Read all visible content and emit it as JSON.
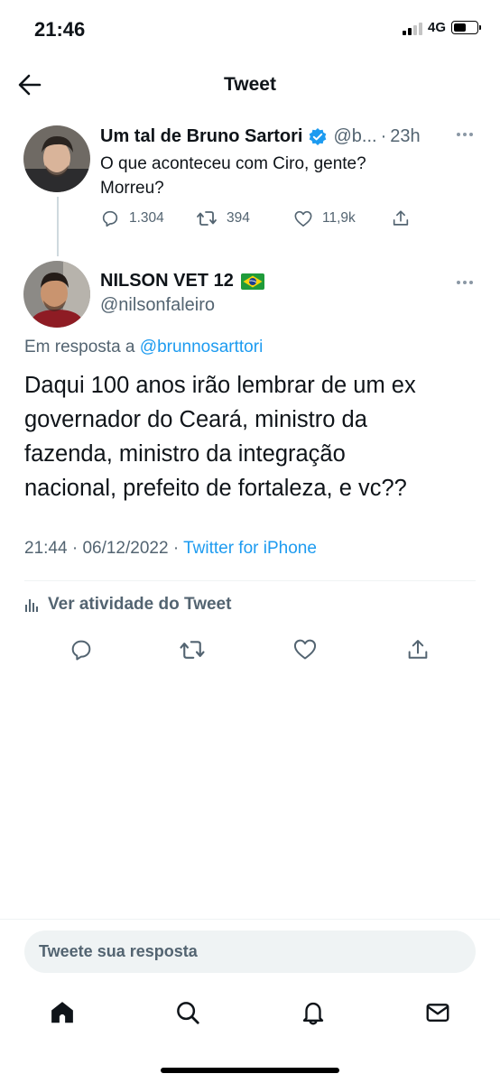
{
  "status_bar": {
    "time": "21:46",
    "network": "4G"
  },
  "header": {
    "title": "Tweet"
  },
  "parent_tweet": {
    "display_name": "Um tal de Bruno Sartori",
    "handle": "@b...",
    "separator": "·",
    "time_ago": "23h",
    "text_line1": "O que aconteceu com Ciro, gente?",
    "text_line2": "Morreu?",
    "replies": "1.304",
    "retweets": "394",
    "likes": "11,9k",
    "verified_badge_color": "#1d9bf0"
  },
  "main_tweet": {
    "display_name": "NILSON VET 12",
    "flag": "🇧🇷",
    "handle": "@nilsonfaleiro",
    "reply_prefix": "Em resposta a ",
    "reply_handle": "@brunnosarttori",
    "text_line1": "Daqui 100 anos irão lembrar de um ex",
    "text_line2": "governador do Ceará, ministro da",
    "text_line3": "fazenda, ministro da integração",
    "text_line4": "nacional, prefeito de fortaleza, e vc??",
    "time": "21:44",
    "separator": "·",
    "date": "06/12/2022",
    "source": "Twitter for iPhone",
    "activity_label": "Ver atividade do Tweet"
  },
  "reply_box": {
    "placeholder": "Tweete sua resposta"
  },
  "colors": {
    "accent": "#1d9bf0",
    "muted": "#536471",
    "text": "#0f1419",
    "divider": "#eff3f4"
  },
  "icons": [
    "back-arrow-icon",
    "verified-icon",
    "more-icon",
    "reply-icon",
    "retweet-icon",
    "like-icon",
    "share-icon",
    "analytics-icon",
    "home-icon",
    "search-icon",
    "notifications-icon",
    "messages-icon"
  ]
}
